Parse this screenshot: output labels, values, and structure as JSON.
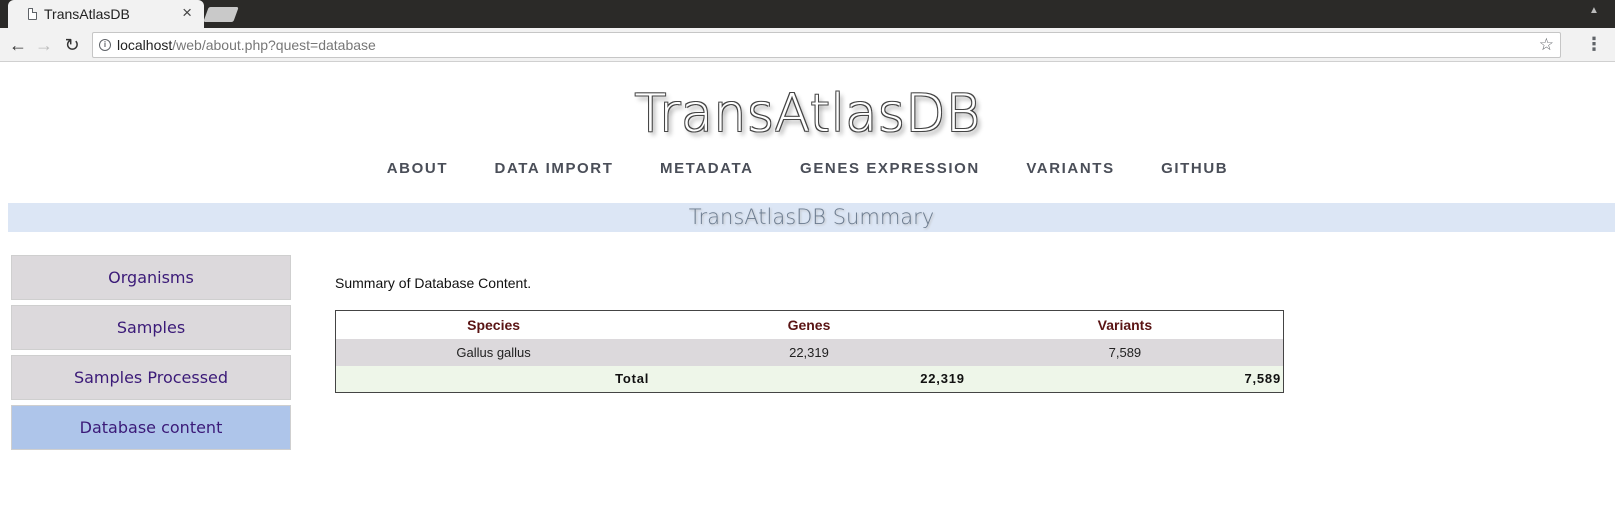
{
  "browser": {
    "tab_title": "TransAtlasDB",
    "tab_close": "×",
    "url_host": "localhost",
    "url_path": "/web/about.php?quest=database"
  },
  "site": {
    "title": "TransAtlasDB"
  },
  "nav": [
    {
      "label": "ABOUT"
    },
    {
      "label": "DATA IMPORT"
    },
    {
      "label": "METADATA"
    },
    {
      "label": "GENES EXPRESSION"
    },
    {
      "label": "VARIANTS"
    },
    {
      "label": "GITHUB"
    }
  ],
  "summary_heading": "TransAtlasDB Summary",
  "sidebar": {
    "items": [
      {
        "label": "Organisms",
        "active": false
      },
      {
        "label": "Samples",
        "active": false
      },
      {
        "label": "Samples Processed",
        "active": false
      },
      {
        "label": "Database content",
        "active": true
      }
    ]
  },
  "content": {
    "intro": "Summary of Database Content.",
    "table": {
      "headers": [
        "Species",
        "Genes",
        "Variants"
      ],
      "rows": [
        [
          "Gallus gallus",
          "22,319",
          "7,589"
        ]
      ],
      "total": {
        "label": "Total",
        "genes": "22,319",
        "variants": "7,589"
      }
    }
  },
  "colors": {
    "accent_link": "#3b1a78",
    "active_sidebar": "#aec5ea",
    "summary_bar": "#dce6f5",
    "header_text": "#5a1414"
  }
}
